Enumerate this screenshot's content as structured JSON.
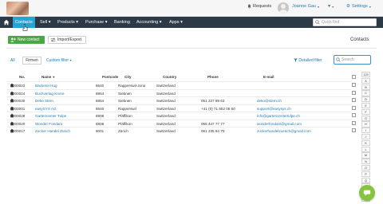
{
  "topbar": {
    "requests_label": "Requests",
    "user_name": "Joanne Gau",
    "settings_label": "Settings"
  },
  "nav": {
    "items": [
      {
        "label": "Contacts",
        "active": true
      },
      {
        "label": "Sell"
      },
      {
        "label": "Products"
      },
      {
        "label": "Purchase"
      },
      {
        "label": "Banking"
      },
      {
        "label": "Accounting"
      },
      {
        "label": "Apps"
      }
    ],
    "search_placeholder": "Quick find"
  },
  "toolbar": {
    "new_contact_label": "New contact",
    "import_export_label": "Import/Export",
    "page_title": "Contacts"
  },
  "filters": {
    "all_label": "All",
    "firmen_label": "Firmen",
    "custom_filter_label": "Custom filter",
    "detailed_filter_label": "Detailed filter",
    "search_placeholder": "Search"
  },
  "table": {
    "headers": [
      "No.",
      "Name",
      "Postcode",
      "City",
      "Country",
      "Phone",
      "E-mail"
    ],
    "rows": [
      {
        "no": "000023",
        "name": "Bäckerei Hug",
        "postcode": "8640",
        "city": "Rapperswil-Jona",
        "country": "Switzerland",
        "phone": "",
        "email": ""
      },
      {
        "no": "000024",
        "name": "Buchverlag Krone",
        "postcode": "8854",
        "city": "Siebnen",
        "country": "Switzerland",
        "phone": "",
        "email": ""
      },
      {
        "no": "000030",
        "name": "Deko Stern",
        "postcode": "8854",
        "city": "Siebnen",
        "country": "Switzerland",
        "phone": "051 227 89 63",
        "email": "deko@stern.ch"
      },
      {
        "no": "000001",
        "name": "easySYS AG",
        "postcode": "8640",
        "city": "Rapperswil",
        "country": "Switzerland",
        "phone": "+41 (0) 71 552 08 60",
        "email": "support@easysys.ch"
      },
      {
        "no": "000028",
        "name": "Gartencenter Tulpe",
        "postcode": "8808",
        "city": "Pfäffikon",
        "country": "Switzerland",
        "phone": "",
        "email": "info@gartencentertulpe.ch"
      },
      {
        "no": "000020",
        "name": "Wonder Fondant",
        "postcode": "8808",
        "city": "Pfäffikon",
        "country": "Switzerland",
        "phone": "055 447 77 77",
        "email": "wonderfondant@gmail.com"
      },
      {
        "no": "000017",
        "name": "Zucker Handel Zürich",
        "postcode": "8001",
        "city": "Zürich",
        "country": "Switzerland",
        "phone": "061 235 84 75",
        "email": "zuckerhandelzuerich@gmail.com"
      }
    ]
  },
  "alphabet": [
    "123",
    "A",
    "B",
    "C",
    "D",
    "E",
    "F",
    "G",
    "H",
    "I",
    "J",
    "K",
    "L",
    "M",
    "N",
    "O",
    "P",
    "Q",
    "R",
    "S",
    "T"
  ],
  "colors": {
    "nav_bg": "#2b3a46",
    "nav_active": "#21a7d0",
    "primary_button": "#49a844",
    "link": "#1f7bb6",
    "chat_button": "#86c440"
  }
}
